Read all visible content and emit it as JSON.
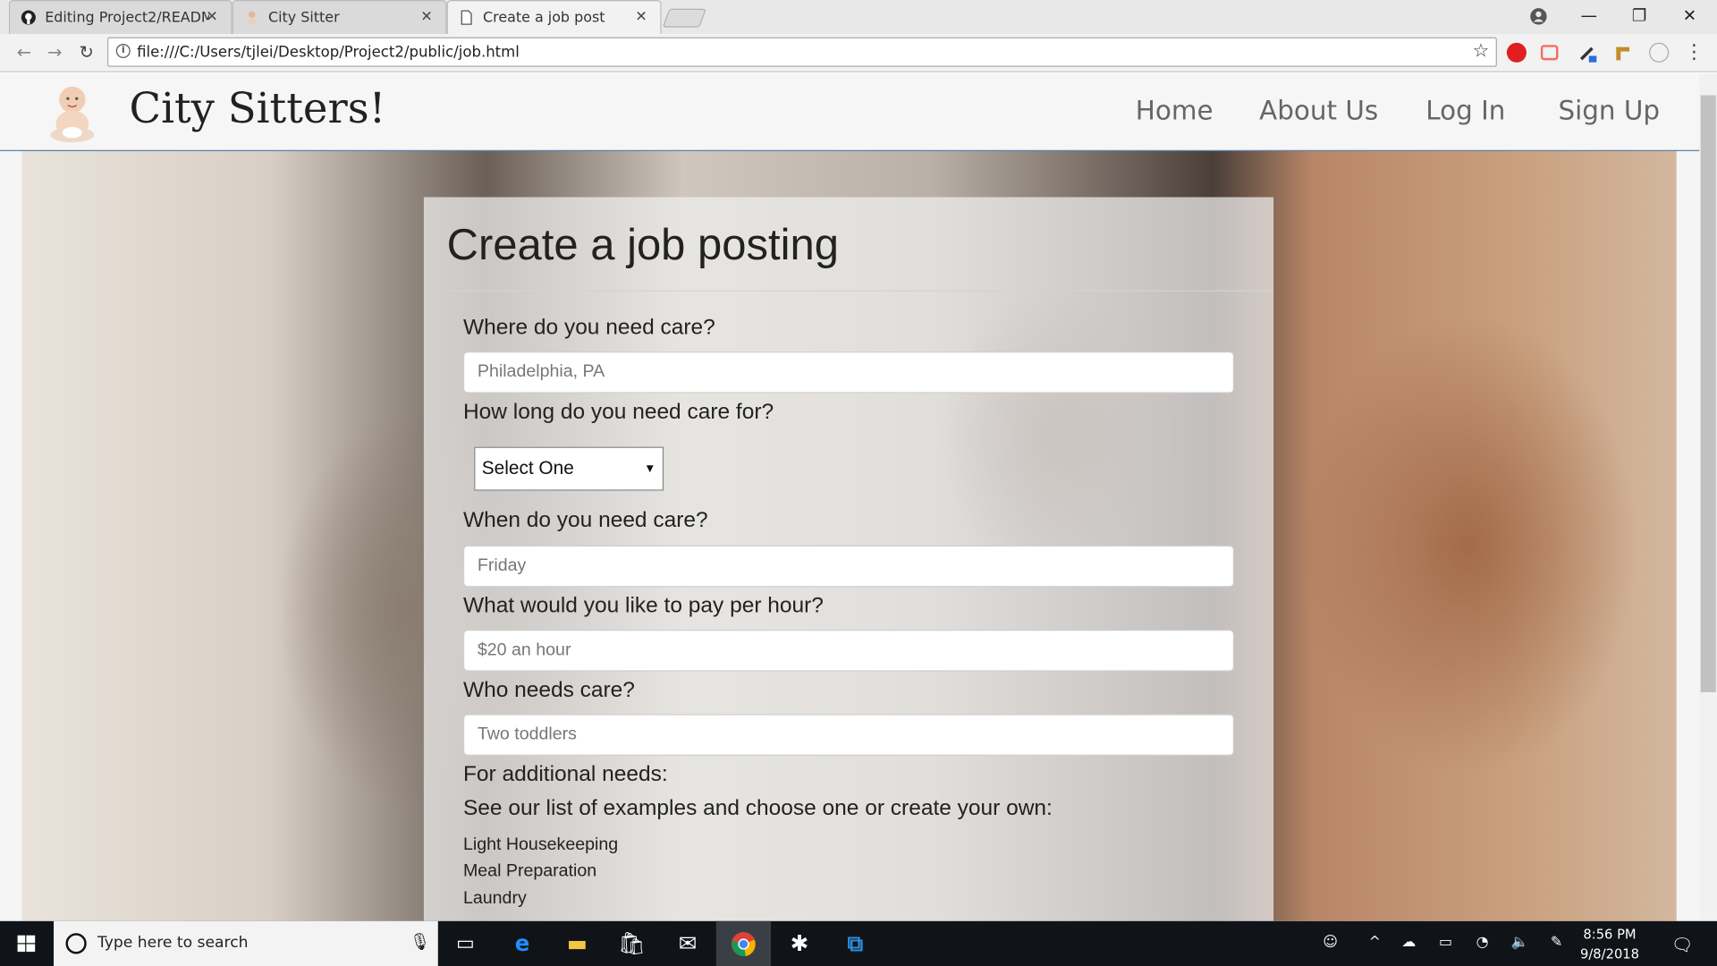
{
  "browser": {
    "tabs": [
      {
        "title": "Editing Project2/READM",
        "icon": "github-icon"
      },
      {
        "title": "City Sitter",
        "icon": "baby-favicon-icon"
      },
      {
        "title": "Create a job post",
        "icon": "page-icon",
        "active": true
      }
    ],
    "url": "file:///C:/Users/tjlei/Desktop/Project2/public/job.html"
  },
  "site": {
    "brand": "City Sitters!",
    "nav": [
      "Home",
      "About Us",
      "Log In",
      "Sign Up"
    ]
  },
  "form": {
    "title": "Create a job posting",
    "location_label": "Where do you need care?",
    "location_placeholder": "Philadelphia, PA",
    "duration_label": "How long do you need care for?",
    "duration_selected": "Select One",
    "when_label": "When do you need care?",
    "when_placeholder": "Friday",
    "pay_label": "What would you like to pay per hour?",
    "pay_placeholder": "$20 an hour",
    "who_label": "Who needs care?",
    "who_placeholder": "Two toddlers",
    "additional_label": "For additional needs:",
    "examples_label": "See our list of examples and choose one or create your own:",
    "examples": [
      "Light Housekeeping",
      "Meal Preparation",
      "Laundry"
    ]
  },
  "taskbar": {
    "search_placeholder": "Type here to search",
    "time": "8:56 PM",
    "date": "9/8/2018"
  }
}
